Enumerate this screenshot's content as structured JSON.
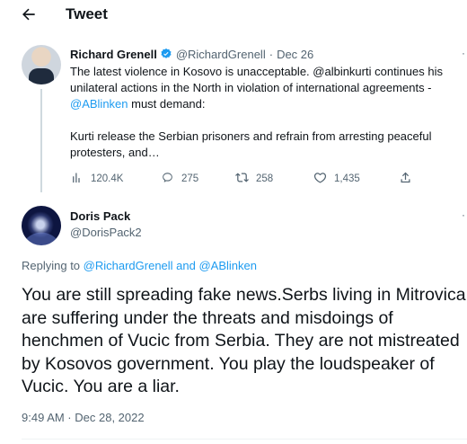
{
  "header": {
    "title": "Tweet"
  },
  "parent_tweet": {
    "author_name": "Richard Grenell",
    "handle": "@RichardGrenell",
    "separator": "·",
    "date": "Dec 26",
    "more": "·",
    "text_part1": "The latest violence in Kosovo is unacceptable. @albinkurti continues his unilateral actions in the North in violation of international agreements - ",
    "mention": "@ABlinken",
    "text_part2": " must demand:",
    "text_para2": "Kurti release the Serbian prisoners and refrain from arresting peaceful protesters, and…",
    "stats": {
      "views": "120.4K",
      "replies": "275",
      "retweets": "258",
      "likes": "1,435"
    }
  },
  "reply_tweet": {
    "author_name": "Doris Pack",
    "handle": "@DorisPack2",
    "more": "·",
    "replying_prefix": "Replying to ",
    "replying_to_1": "@RichardGrenell",
    "replying_and": " and ",
    "replying_to_2": "@ABlinken",
    "text": "You are still spreading fake news.Serbs living in Mitrovica are suffering under the threats and misdoings of henchmen of Vucic from Serbia. They are not mistreated by Kosovos government. You play the loudspeaker of Vucic. You are a liar.",
    "timestamp": "9:49 AM · Dec 28, 2022"
  },
  "colors": {
    "accent": "#1d9bf0",
    "secondary_text": "#536471",
    "primary_text": "#0f1419"
  },
  "icons": [
    "back-arrow-icon",
    "verified-badge-icon",
    "views-icon",
    "reply-icon",
    "retweet-icon",
    "like-icon",
    "share-icon"
  ]
}
